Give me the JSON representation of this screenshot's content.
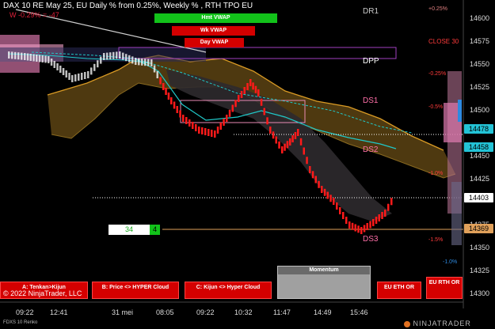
{
  "header": {
    "title": "DAX 10  RE May 25, EU Daily % from 0.25%, Weekly % , RTH TPO EU",
    "overlay_text": "W -0.29% = -47"
  },
  "vwap": {
    "hmt": "Hmt VWAP",
    "wk": "Wk VWAP",
    "day": "Day VWAP"
  },
  "levels": {
    "dr1": "DR1",
    "close": "CLOSE 30",
    "dpp": "DPP",
    "ds1": "DS1",
    "ds2": "DS2",
    "ds3": "DS3"
  },
  "right_pcts": {
    "p1": "+0.25%",
    "p2": "-0.25%",
    "p3": "-0.5%",
    "p4": "-1.0%",
    "p5": "-1.5%",
    "p6": "-1.0%"
  },
  "y_axis": [
    "14600",
    "14575",
    "14550",
    "14525",
    "14500",
    "14450",
    "14425",
    "14375",
    "14350",
    "14325",
    "14300"
  ],
  "price_tags": [
    {
      "value": "14478",
      "color": "#23c3d6"
    },
    {
      "value": "14458",
      "color": "#23c3d6"
    },
    {
      "value": "14403",
      "color": "#ffffff"
    },
    {
      "value": "14369",
      "color": "#e0a05a"
    }
  ],
  "x_axis": [
    "09:22",
    "12:41",
    "31 mei",
    "08:05",
    "09:22",
    "10:32",
    "11:47",
    "14:49",
    "15:46"
  ],
  "counter": {
    "value": "34",
    "badge": "4"
  },
  "buttons": {
    "tenkan": "A: Tenkan>Kijun",
    "price": "B: Price <> HYPER Cloud",
    "kijun": "C: Kijun <> Hyper Cloud",
    "momentum": "Momentum",
    "eth": "EU ETH OR",
    "rth": "EU RTH OR"
  },
  "footer": {
    "copyright": "© 2022 NinjaTrader, LLC",
    "instrument": "FDXS 10 Renko",
    "brand": "NINJATRADER"
  },
  "colors": {
    "up": "#ffffff",
    "down": "#ff1a1a",
    "cloud": "#b8860b",
    "vwap": "#20c8c8"
  }
}
